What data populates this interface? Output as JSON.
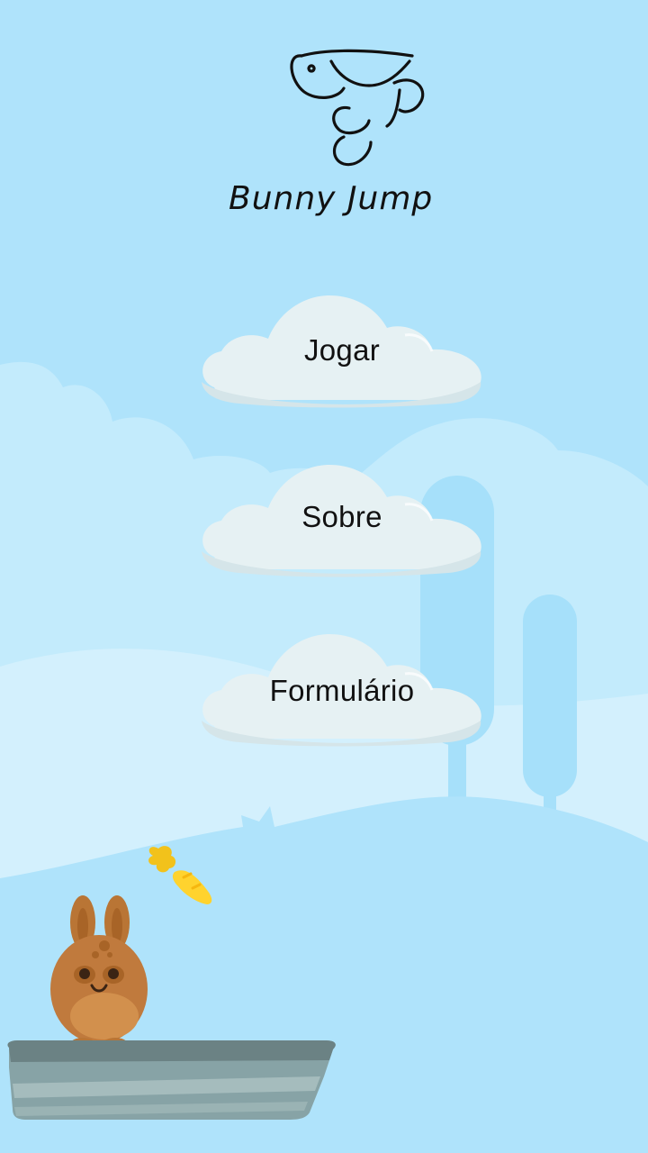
{
  "app": {
    "title": "Bunny Jump"
  },
  "menu": {
    "play_label": "Jogar",
    "about_label": "Sobre",
    "form_label": "Formulário"
  },
  "colors": {
    "sky": "#afe3fb",
    "cloud_far": "#c3ebfc",
    "hill": "#d3f0fd",
    "tree": "#a6e0fa",
    "button_cloud": "#e6f1f3",
    "button_cloud_shade": "#d5e5e9",
    "bunny": "#c07a3d",
    "platform": "#7e9a9e"
  },
  "icons": {
    "logo": "bunny-jump-logo",
    "player": "bunny-icon",
    "collectible": "carrot-icon"
  }
}
